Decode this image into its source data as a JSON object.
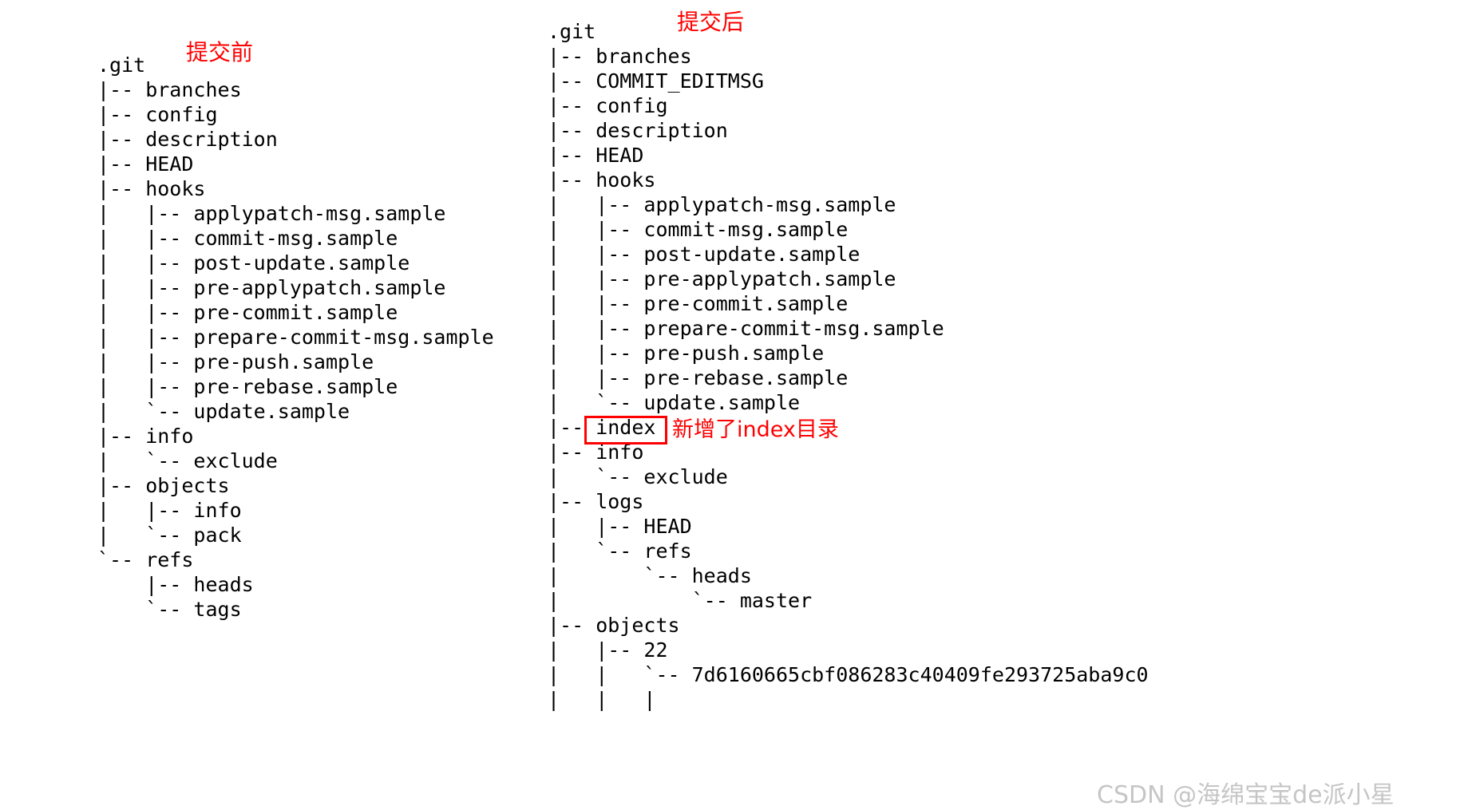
{
  "trees": {
    "before": {
      "annotation": "提交前",
      "lines": [
        ".git",
        "|-- branches",
        "|-- config",
        "|-- description",
        "|-- HEAD",
        "|-- hooks",
        "|   |-- applypatch-msg.sample",
        "|   |-- commit-msg.sample",
        "|   |-- post-update.sample",
        "|   |-- pre-applypatch.sample",
        "|   |-- pre-commit.sample",
        "|   |-- prepare-commit-msg.sample",
        "|   |-- pre-push.sample",
        "|   |-- pre-rebase.sample",
        "|   `-- update.sample",
        "|-- info",
        "|   `-- exclude",
        "|-- objects",
        "|   |-- info",
        "|   `-- pack",
        "`-- refs",
        "    |-- heads",
        "    `-- tags"
      ]
    },
    "after": {
      "annotation": "提交后",
      "lines": [
        ".git",
        "|-- branches",
        "|-- COMMIT_EDITMSG",
        "|-- config",
        "|-- description",
        "|-- HEAD",
        "|-- hooks",
        "|   |-- applypatch-msg.sample",
        "|   |-- commit-msg.sample",
        "|   |-- post-update.sample",
        "|   |-- pre-applypatch.sample",
        "|   |-- pre-commit.sample",
        "|   |-- prepare-commit-msg.sample",
        "|   |-- pre-push.sample",
        "|   |-- pre-rebase.sample",
        "|   `-- update.sample",
        "|-- index",
        "|-- info",
        "|   `-- exclude",
        "|-- logs",
        "|   |-- HEAD",
        "|   `-- refs",
        "|       `-- heads",
        "|           `-- master",
        "|-- objects",
        "|   |-- 22",
        "|   |   `-- 7d6160665cbf086283c40409fe293725aba9c0",
        "|   |   |"
      ],
      "index_annotation": "新增了index目录"
    }
  },
  "watermark": "CSDN @海绵宝宝de派小星",
  "colors": {
    "annotation_red": "#ff0000",
    "text_black": "#000000",
    "background": "#ffffff"
  }
}
